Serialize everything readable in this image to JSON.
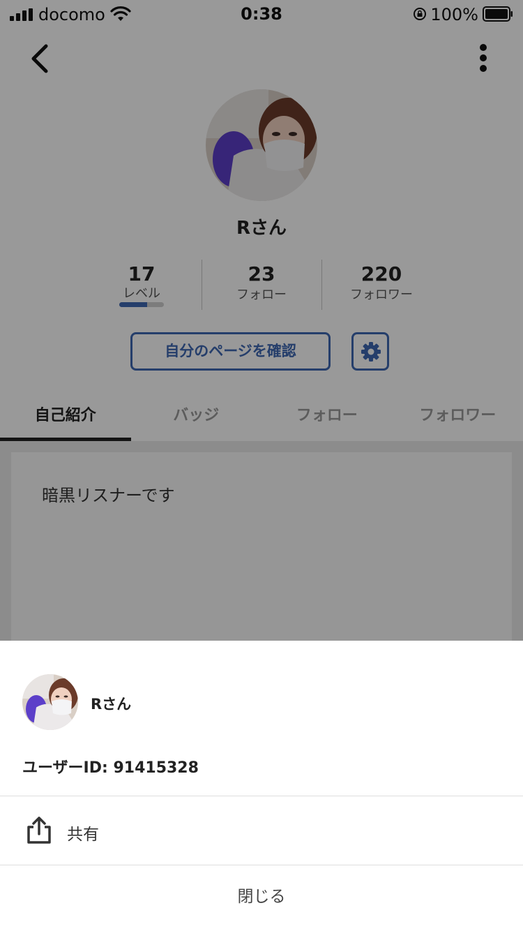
{
  "status_bar": {
    "carrier": "docomo",
    "time": "0:38",
    "battery": "100%"
  },
  "header": {
    "back_icon": "chevron-left-icon",
    "more_icon": "more-vertical-icon"
  },
  "profile": {
    "name": "Rさん",
    "stats": [
      {
        "value": "17",
        "label": "レベル"
      },
      {
        "value": "23",
        "label": "フォロー"
      },
      {
        "value": "220",
        "label": "フォロワー"
      }
    ],
    "level_progress": 0.62,
    "my_page_button": "自分のページを確認",
    "settings_icon": "gear-icon",
    "accent_color": "#3e68b2"
  },
  "tabs": [
    {
      "label": "自己紹介",
      "active": true
    },
    {
      "label": "バッジ",
      "active": false
    },
    {
      "label": "フォロー",
      "active": false
    },
    {
      "label": "フォロワー",
      "active": false
    }
  ],
  "intro": {
    "text": "暗黒リスナーです"
  },
  "sheet": {
    "name": "Rさん",
    "user_id": "ユーザーID: 91415328",
    "share_icon": "share-icon",
    "share_label": "共有",
    "close_label": "閉じる"
  }
}
